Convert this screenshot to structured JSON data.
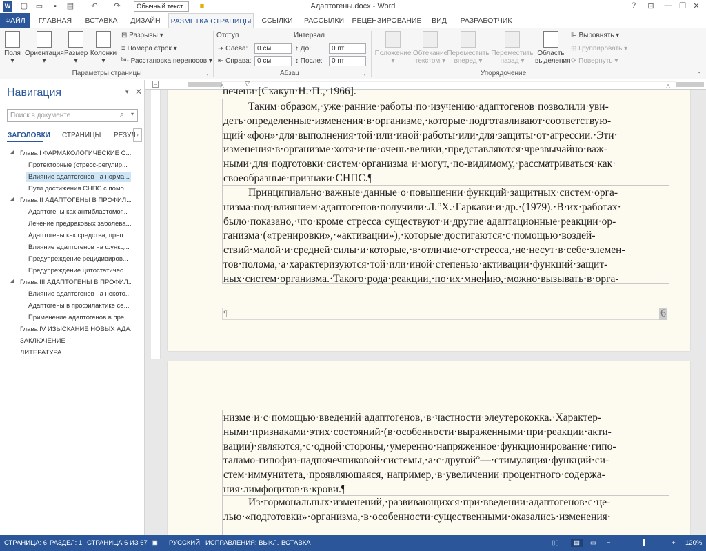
{
  "window": {
    "title": "Адаптогены.docx - Word"
  },
  "qat": {
    "style_box": "Обычный текст",
    "help": "?",
    "minimize": "—",
    "restore": "❐",
    "close": "✕",
    "ribbon_opts": "⊡"
  },
  "tabs": [
    "ФАЙЛ",
    "ГЛАВНАЯ",
    "ВСТАВКА",
    "ДИЗАЙН",
    "РАЗМЕТКА СТРАНИЦЫ",
    "ССЫЛКИ",
    "РАССЫЛКИ",
    "РЕЦЕНЗИРОВАНИЕ",
    "ВИД",
    "РАЗРАБОТЧИК"
  ],
  "ribbon": {
    "page_setup": {
      "fields": [
        "Поля",
        "Ориентация",
        "Размер",
        "Колонки"
      ],
      "breaks": "Разрывы",
      "line_numbers": "Номера строк",
      "hyphenation": "Расстановка переносов",
      "group": "Параметры страницы"
    },
    "paragraph": {
      "indent": "Отступ",
      "spacing": "Интервал",
      "left_label": "Слева:",
      "right_label": "Справа:",
      "before_label": "До:",
      "after_label": "После:",
      "left_val": "0 см",
      "right_val": "0 см",
      "before_val": "0 пт",
      "after_val": "0 пт",
      "group": "Абзац"
    },
    "arrange": {
      "position": "Положение",
      "wrap": "Обтекание текстом",
      "forward": "Переместить вперед",
      "backward": "Переместить назад",
      "selection": "Область выделения",
      "align": "Выровнять",
      "group_btn": "Группировать",
      "rotate": "Повернуть",
      "group": "Упорядочение"
    }
  },
  "nav": {
    "title": "Навигация",
    "search_placeholder": "Поиск в документе",
    "tabs": [
      "ЗАГОЛОВКИ",
      "СТРАНИЦЫ",
      "РЕЗУЛ"
    ],
    "items": [
      {
        "text": "Глава I ФАРМАКОЛОГИЧЕСКИЕ С...",
        "level": 1
      },
      {
        "text": "Протекторные (стресс-регулир...",
        "level": 2
      },
      {
        "text": "Влияние адаптогенов на норма...",
        "level": 2,
        "selected": true
      },
      {
        "text": "Пути достижения СНПС с помо...",
        "level": 2
      },
      {
        "text": "Глава II АДАПТОГЕНЫ В ПРОФИЛ...",
        "level": 1
      },
      {
        "text": "Адаптогены как антибластомог...",
        "level": 2
      },
      {
        "text": "Лечение предраковых заболева...",
        "level": 2
      },
      {
        "text": "Адаптогены как средства, преп...",
        "level": 2
      },
      {
        "text": "Влияние адаптогенов на функц...",
        "level": 2
      },
      {
        "text": "Предупреждение рецидивиров...",
        "level": 2
      },
      {
        "text": "Предупреждение цитостатичес...",
        "level": 2
      },
      {
        "text": "Глава III АДАПТОГЕНЫ В ПРОФИЛ...",
        "level": 1
      },
      {
        "text": "Влияние адаптогенов на некото...",
        "level": 2
      },
      {
        "text": "Адаптогены в профилактике се...",
        "level": 2
      },
      {
        "text": "Применение адаптогенов в пре...",
        "level": 2
      },
      {
        "text": "Глава IV ИЗЫСКАНИЕ НОВЫХ АДА...",
        "level": 0
      },
      {
        "text": "ЗАКЛЮЧЕНИЕ",
        "level": 0
      },
      {
        "text": "ЛИТЕРАТУРА",
        "level": 0
      }
    ]
  },
  "document": {
    "page1_top_line": "печени·[Скакун·Н.·П.,·1966].",
    "para1": [
      "Таким·образом,·уже·ранние·работы·по·изучению·адаптогенов·позволили·уви-",
      "деть·определенные·изменения·в·организме,·которые·подготавливают·соответствую-",
      "щий·«фон»·для·выполнения·той·или·иной·работы·или·для·защиты·от·агрессии.·Эти·",
      "изменения·в·организме·хотя·и·не·очень·велики,·представляются·чрезвычайно·важ-",
      "ными·для·подготовки·систем·организма·и·могут,·по-видимому,·рассматриваться·как·",
      "своеобразные·признаки·СНПС.¶"
    ],
    "para2": [
      "Принципиально·важные·данные·о·повышении·функций·защитных·систем·орга-",
      "низма·под·влиянием·адаптогенов·получили·Л.°Х.·Гаркави·и·др.·(1979).·В·их·работах·",
      "было·показано,·что·кроме·стресса·существуют·и·другие·адаптационные·реакции·ор-",
      "ганизма·(«тренировки»,·«активации»),·которые·достигаются·с·помощью·воздей-",
      "ствий·малой·и·средней·силы·и·которые,·в·отличие·от·стресса,·не·несут·в·себе·элемен-",
      "тов·полома,·а·характеризуются·той·или·иной·степенью·активации·функций·защит-",
      "ных·систем·организма.·Такого·рода·реакции,·по·их·мнению,·можно·вызывать·в·орга-"
    ],
    "footer_mark": "¶",
    "page_number": "6",
    "para3": [
      "низме·и·с·помощью·введений·адаптогенов,·в·частности·элеутерококка.·Характер-",
      "ными·признаками·этих·состояний·(в·особенности·выраженными·при·реакции·акти-",
      "вации)·являются,·с·одной·стороны,·умеренно·напряженное·функционирование·гипо-",
      "таламо-гипофиз-надпочечниковой·системы,·а·с·другой°—·стимуляция·функций·си-",
      "стем·иммунитета,·проявляющаяся,·например,·в·увеличении·процентного·содержа-",
      "ния·лимфоцитов·в·крови.¶"
    ],
    "para4": [
      "Из·гормональных·изменений,·развивающихся·при·введении·адаптогенов·с·це-",
      "лью·«подготовки»·организма,·в·особенности·существенными·оказались·изменения·"
    ]
  },
  "status": {
    "page": "СТРАНИЦА: 6",
    "section": "РАЗДЕЛ: 1",
    "page_of": "СТРАНИЦА 6 ИЗ 67",
    "language": "РУССКИЙ",
    "track": "ИСПРАВЛЕНИЯ: ВЫКЛ.",
    "insert": "ВСТАВКА",
    "zoom": "120%"
  }
}
